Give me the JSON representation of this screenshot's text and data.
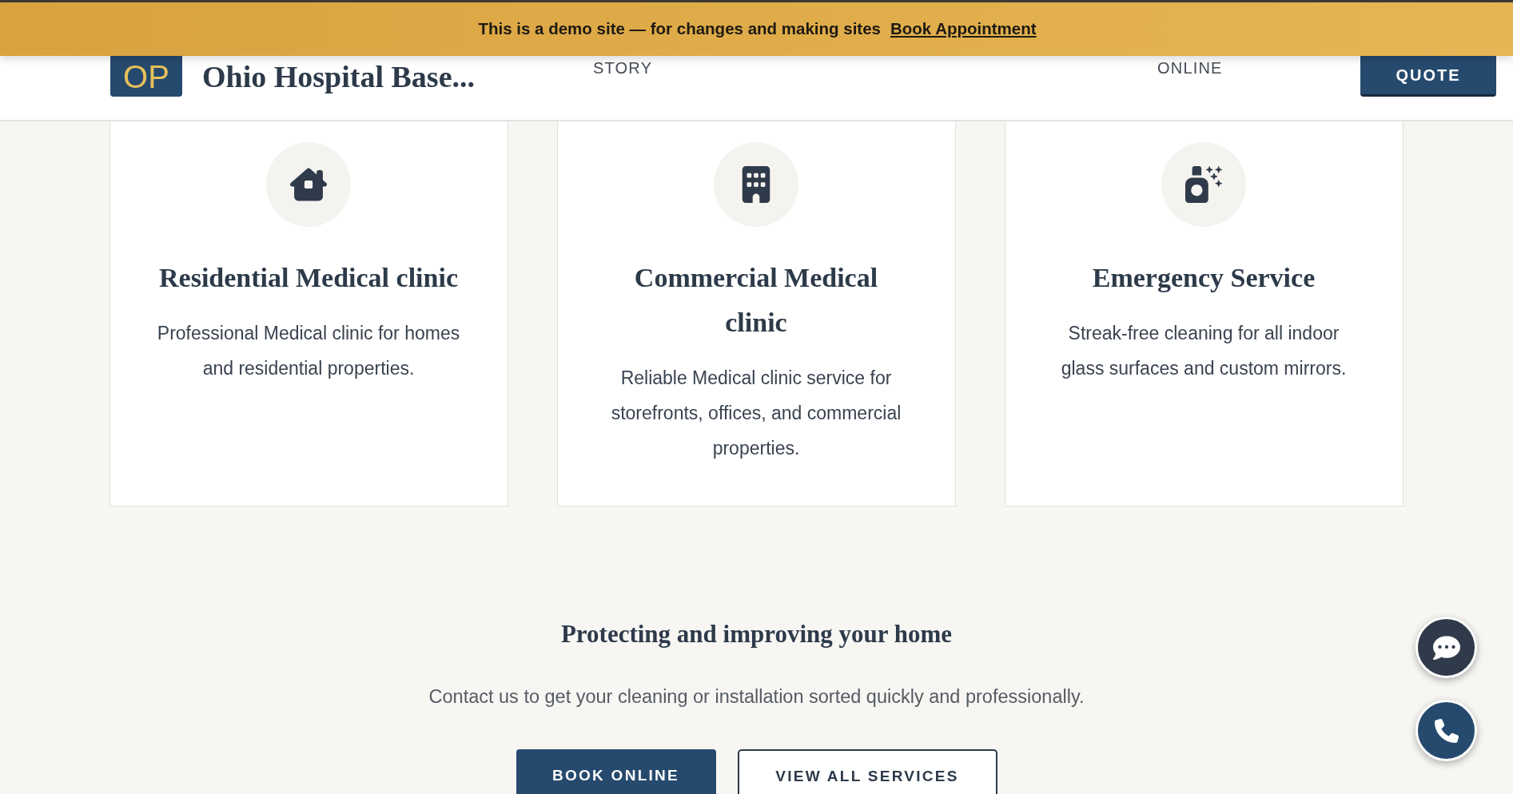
{
  "banner": {
    "text": "This is a demo site — for changes and making sites",
    "link": "Book Appointment"
  },
  "header": {
    "logo_initials": "OP",
    "site_name": "Ohio Hospital Base...",
    "nav": [
      "STORY",
      "ONLINE"
    ],
    "cta": "QUOTE"
  },
  "services": [
    {
      "kind": "house",
      "title": "Residential Medical clinic",
      "description": "Professional Medical clinic for homes and residential properties."
    },
    {
      "kind": "building",
      "title": "Commercial Medical clinic",
      "description": "Reliable Medical clinic service for storefronts, offices, and commercial properties."
    },
    {
      "kind": "spray",
      "title": "Emergency Service",
      "description": "Streak-free cleaning for all indoor glass surfaces and custom mirrors."
    }
  ],
  "cta_section": {
    "title": "Protecting and improving your home",
    "subtitle": "Contact us to get your cleaning or installation sorted quickly and professionally.",
    "buttons": [
      {
        "kind": "primary",
        "label": "BOOK ONLINE"
      },
      {
        "kind": "outline",
        "label": "VIEW ALL SERVICES"
      }
    ]
  },
  "floating_buttons": [
    {
      "kind": "chat"
    },
    {
      "kind": "phone"
    }
  ]
}
